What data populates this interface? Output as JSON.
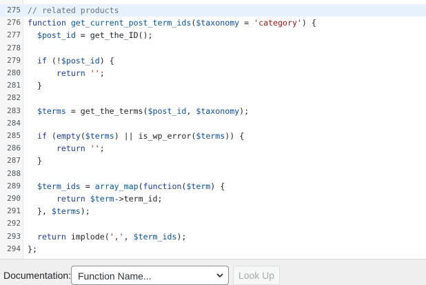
{
  "editor": {
    "lines": [
      {
        "num": "275",
        "active": true,
        "tokens": [
          {
            "t": "// related products",
            "c": "comment"
          }
        ]
      },
      {
        "num": "276",
        "tokens": [
          {
            "t": "function ",
            "c": "kw"
          },
          {
            "t": "get_current_post_term_ids",
            "c": "fn"
          },
          {
            "t": "(",
            "c": ""
          },
          {
            "t": "$taxonomy",
            "c": "var"
          },
          {
            "t": " = ",
            "c": ""
          },
          {
            "t": "'category'",
            "c": "str"
          },
          {
            "t": ") {",
            "c": ""
          }
        ]
      },
      {
        "num": "277",
        "tokens": [
          {
            "t": "  ",
            "c": ""
          },
          {
            "t": "$post_id",
            "c": "var"
          },
          {
            "t": " = get_the_ID();",
            "c": ""
          }
        ]
      },
      {
        "num": "278",
        "tokens": []
      },
      {
        "num": "279",
        "tokens": [
          {
            "t": "  ",
            "c": ""
          },
          {
            "t": "if",
            "c": "kw"
          },
          {
            "t": " (!",
            "c": ""
          },
          {
            "t": "$post_id",
            "c": "var"
          },
          {
            "t": ") {",
            "c": ""
          }
        ]
      },
      {
        "num": "280",
        "tokens": [
          {
            "t": "      ",
            "c": ""
          },
          {
            "t": "return",
            "c": "kw"
          },
          {
            "t": " ",
            "c": ""
          },
          {
            "t": "''",
            "c": "str"
          },
          {
            "t": ";",
            "c": ""
          }
        ]
      },
      {
        "num": "281",
        "tokens": [
          {
            "t": "  }",
            "c": ""
          }
        ]
      },
      {
        "num": "282",
        "tokens": []
      },
      {
        "num": "283",
        "tokens": [
          {
            "t": "  ",
            "c": ""
          },
          {
            "t": "$terms",
            "c": "var"
          },
          {
            "t": " = get_the_terms(",
            "c": ""
          },
          {
            "t": "$post_id",
            "c": "var"
          },
          {
            "t": ", ",
            "c": ""
          },
          {
            "t": "$taxonomy",
            "c": "var"
          },
          {
            "t": ");",
            "c": ""
          }
        ]
      },
      {
        "num": "284",
        "tokens": []
      },
      {
        "num": "285",
        "tokens": [
          {
            "t": "  ",
            "c": ""
          },
          {
            "t": "if",
            "c": "kw"
          },
          {
            "t": " (",
            "c": ""
          },
          {
            "t": "empty",
            "c": "kw"
          },
          {
            "t": "(",
            "c": ""
          },
          {
            "t": "$terms",
            "c": "var"
          },
          {
            "t": ") || is_wp_error(",
            "c": ""
          },
          {
            "t": "$terms",
            "c": "var"
          },
          {
            "t": ")) {",
            "c": ""
          }
        ]
      },
      {
        "num": "286",
        "tokens": [
          {
            "t": "      ",
            "c": ""
          },
          {
            "t": "return",
            "c": "kw"
          },
          {
            "t": " ",
            "c": ""
          },
          {
            "t": "''",
            "c": "str"
          },
          {
            "t": ";",
            "c": ""
          }
        ]
      },
      {
        "num": "287",
        "tokens": [
          {
            "t": "  }",
            "c": ""
          }
        ]
      },
      {
        "num": "288",
        "tokens": []
      },
      {
        "num": "289",
        "tokens": [
          {
            "t": "  ",
            "c": ""
          },
          {
            "t": "$term_ids",
            "c": "var"
          },
          {
            "t": " = ",
            "c": ""
          },
          {
            "t": "array_map",
            "c": "fn"
          },
          {
            "t": "(",
            "c": ""
          },
          {
            "t": "function",
            "c": "kw"
          },
          {
            "t": "(",
            "c": ""
          },
          {
            "t": "$term",
            "c": "var"
          },
          {
            "t": ") {",
            "c": ""
          }
        ]
      },
      {
        "num": "290",
        "tokens": [
          {
            "t": "      ",
            "c": ""
          },
          {
            "t": "return",
            "c": "kw"
          },
          {
            "t": " ",
            "c": ""
          },
          {
            "t": "$term",
            "c": "var"
          },
          {
            "t": "->term_id;",
            "c": ""
          }
        ]
      },
      {
        "num": "291",
        "tokens": [
          {
            "t": "  }, ",
            "c": ""
          },
          {
            "t": "$terms",
            "c": "var"
          },
          {
            "t": ");",
            "c": ""
          }
        ]
      },
      {
        "num": "292",
        "tokens": []
      },
      {
        "num": "293",
        "tokens": [
          {
            "t": "  ",
            "c": ""
          },
          {
            "t": "return",
            "c": "kw"
          },
          {
            "t": " implode(",
            "c": ""
          },
          {
            "t": "','",
            "c": "str"
          },
          {
            "t": ", ",
            "c": ""
          },
          {
            "t": "$term_ids",
            "c": "var"
          },
          {
            "t": ");",
            "c": ""
          }
        ]
      },
      {
        "num": "294",
        "tokens": [
          {
            "t": "};",
            "c": ""
          }
        ]
      }
    ]
  },
  "docbar": {
    "label": "Documentation:",
    "select_value": "Function Name...",
    "lookup_label": "Look Up"
  },
  "icons": {
    "chevron": "chevron-down-icon"
  }
}
